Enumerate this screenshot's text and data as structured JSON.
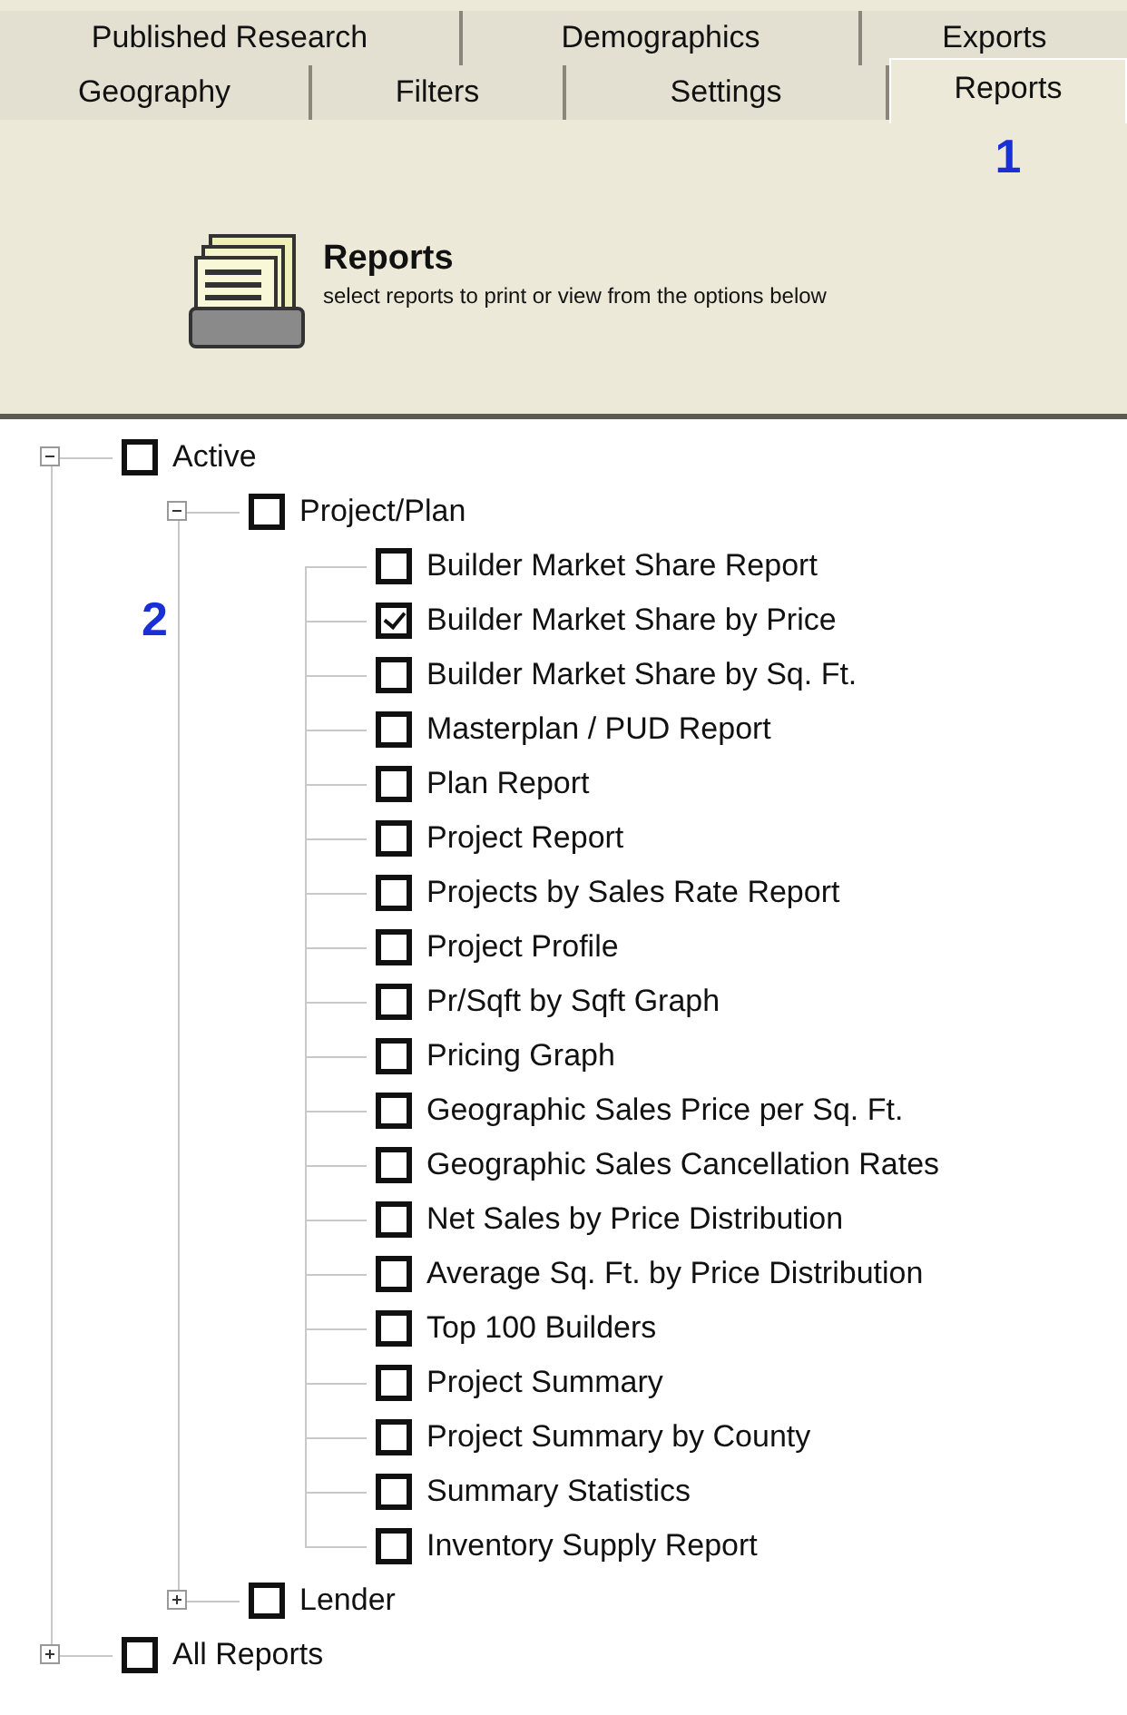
{
  "tab_rows": [
    [
      {
        "label": "Published Research",
        "selected": false
      },
      {
        "label": "Demographics",
        "selected": false
      },
      {
        "label": "Exports",
        "selected": false
      }
    ],
    [
      {
        "label": "Geography",
        "selected": false
      },
      {
        "label": "Filters",
        "selected": false
      },
      {
        "label": "Settings",
        "selected": false
      },
      {
        "label": "Reports",
        "selected": true,
        "callout": "1"
      }
    ]
  ],
  "panel": {
    "title": "Reports",
    "description": "select reports to print or view from the options below"
  },
  "tree": [
    {
      "label": "Active",
      "checked": false,
      "expanded": true,
      "children": [
        {
          "label": "Project/Plan",
          "checked": false,
          "expanded": true,
          "children": [
            {
              "label": "Builder Market Share Report",
              "checked": false
            },
            {
              "label": "Builder Market Share by Price",
              "checked": true,
              "callout": "2"
            },
            {
              "label": "Builder Market Share by Sq. Ft.",
              "checked": false
            },
            {
              "label": "Masterplan / PUD Report",
              "checked": false
            },
            {
              "label": "Plan Report",
              "checked": false
            },
            {
              "label": "Project Report",
              "checked": false
            },
            {
              "label": "Projects by Sales Rate Report",
              "checked": false
            },
            {
              "label": "Project Profile",
              "checked": false
            },
            {
              "label": "Pr/Sqft by Sqft Graph",
              "checked": false
            },
            {
              "label": "Pricing Graph",
              "checked": false
            },
            {
              "label": "Geographic Sales Price per Sq. Ft.",
              "checked": false
            },
            {
              "label": "Geographic Sales Cancellation Rates",
              "checked": false
            },
            {
              "label": "Net Sales by Price Distribution",
              "checked": false
            },
            {
              "label": "Average Sq. Ft. by Price Distribution",
              "checked": false
            },
            {
              "label": "Top 100 Builders",
              "checked": false
            },
            {
              "label": "Project Summary",
              "checked": false
            },
            {
              "label": "Project Summary by County",
              "checked": false
            },
            {
              "label": "Summary Statistics",
              "checked": false
            },
            {
              "label": "Inventory Supply Report",
              "checked": false
            }
          ]
        },
        {
          "label": "Lender",
          "checked": false,
          "expanded": false
        }
      ]
    },
    {
      "label": "All Reports",
      "checked": false,
      "expanded": false
    }
  ]
}
